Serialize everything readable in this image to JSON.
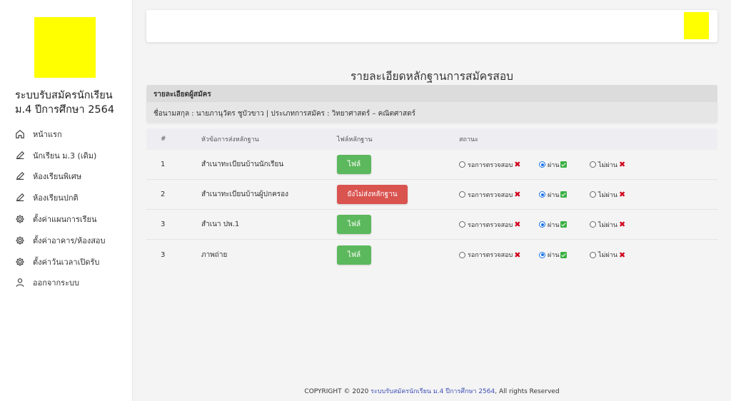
{
  "sidebar": {
    "app_title": "ระบบรับสมัครนักเรียน ม.4 ปีการศึกษา 2564",
    "items": [
      {
        "label": "หน้าแรก",
        "icon": "home-icon"
      },
      {
        "label": "นักเรียน ม.3 (เดิม)",
        "icon": "pencil-icon"
      },
      {
        "label": "ห้องเรียนพิเศษ",
        "icon": "pencil-icon"
      },
      {
        "label": "ห้องเรียนปกติ",
        "icon": "pencil-icon"
      },
      {
        "label": "ตั้งค่าแผนการเรียน",
        "icon": "gear-icon"
      },
      {
        "label": "ตั้งค่าอาคาร/ห้องสอบ",
        "icon": "gear-icon"
      },
      {
        "label": "ตั้งค่าวันเวลาเปิดรับ",
        "icon": "gear-icon"
      },
      {
        "label": "ออกจากระบบ",
        "icon": "user-icon"
      }
    ]
  },
  "main": {
    "title": "รายละเอียดหลักฐานการสมัครสอบ",
    "card": {
      "header": "รายละเอียดผู้สมัคร",
      "body": "ชื่อนามสกุล : นายภานุวัตร ชูบัวขาว | ประเภทการสมัคร : วิทยาศาสตร์ – คณิตศาสตร์"
    },
    "table": {
      "headers": [
        "#",
        "หัวข้อการส่งหลักฐาน",
        "ไฟล์หลักฐาน",
        "สถานะ"
      ],
      "status_options": [
        "รอการตรวจสอบ",
        "ผ่าน",
        "ไม่ผ่าน"
      ],
      "rows": [
        {
          "num": "1",
          "name": "สำเนาทะเบียนบ้านนักเรียน",
          "file_label": "ไฟล์",
          "file_state": "file",
          "status": "ผ่าน"
        },
        {
          "num": "2",
          "name": "สำเนาทะเบียนบ้านผู้ปกครอง",
          "file_label": "ยังไม่ส่งหลักฐาน",
          "file_state": "missing",
          "status": "ผ่าน"
        },
        {
          "num": "3",
          "name": "สำเนา ปพ.1",
          "file_label": "ไฟล์",
          "file_state": "file",
          "status": "ผ่าน"
        },
        {
          "num": "3",
          "name": "ภาพถ่าย",
          "file_label": "ไฟล์",
          "file_state": "file",
          "status": "ผ่าน"
        }
      ]
    }
  },
  "footer": {
    "prefix": "COPYRIGHT © 2020 ",
    "link": "ระบบรับสมัครนักเรียน ม.4 ปีการศึกษา 2564",
    "suffix": ", All rights Reserved"
  },
  "colors": {
    "logo": "#ffff00",
    "btn_file": "#5cb85c",
    "btn_missing": "#d9534f",
    "radio_checked": "#1a73e8",
    "footer_link": "#3f51b5"
  }
}
